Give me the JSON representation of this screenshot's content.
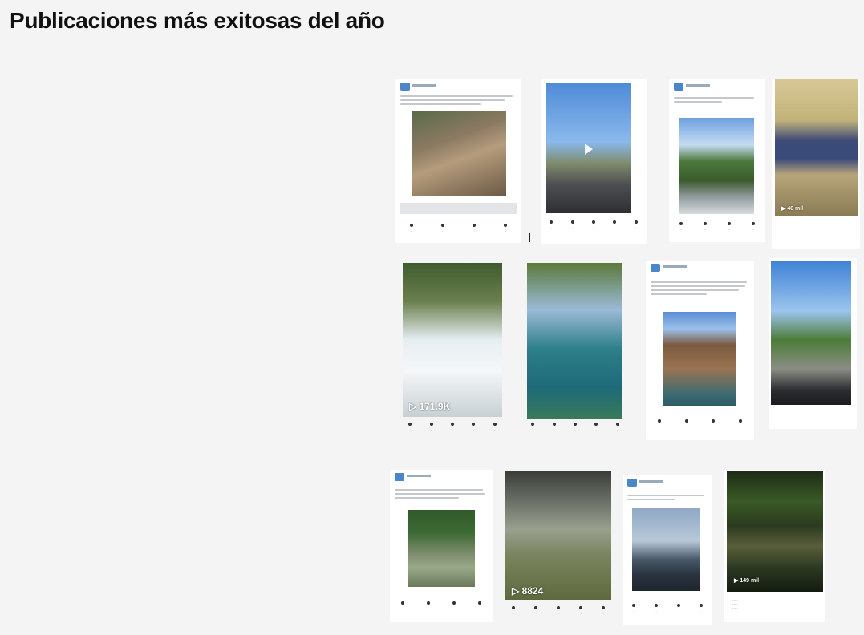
{
  "page": {
    "title": "Publicaciones más exitosas del año"
  },
  "row2": {
    "falls_views": "▷ 171.9K"
  },
  "row3": {
    "pool_views": "▷ 8824",
    "croc_views": "▶ 149 mil"
  },
  "row1": {
    "man_views": "▶ 40 mil"
  }
}
